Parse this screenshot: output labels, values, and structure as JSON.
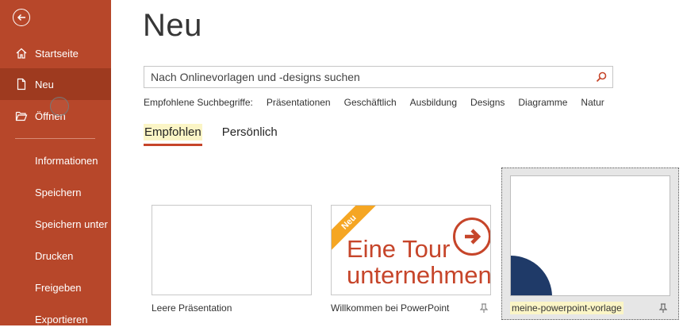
{
  "sidebar": {
    "items": [
      {
        "label": "Startseite",
        "icon": "home-icon"
      },
      {
        "label": "Neu",
        "icon": "new-file-icon",
        "active": true
      },
      {
        "label": "Öffnen",
        "icon": "folder-open-icon"
      }
    ],
    "sub_items": [
      {
        "label": "Informationen"
      },
      {
        "label": "Speichern"
      },
      {
        "label": "Speichern unter"
      },
      {
        "label": "Drucken"
      },
      {
        "label": "Freigeben"
      },
      {
        "label": "Exportieren"
      }
    ],
    "accent": "#b7472a"
  },
  "main": {
    "title": "Neu",
    "search": {
      "placeholder": "Nach Onlinevorlagen und -designs suchen"
    },
    "suggestions": {
      "lead": "Empfohlene Suchbegriffe:",
      "terms": [
        "Präsentationen",
        "Geschäftlich",
        "Ausbildung",
        "Designs",
        "Diagramme",
        "Natur"
      ]
    },
    "tabs": [
      {
        "label": "Empfohlen",
        "active": true
      },
      {
        "label": "Persönlich"
      }
    ],
    "templates": [
      {
        "label": "Leere Präsentation"
      },
      {
        "label": "Willkommen bei PowerPoint",
        "badge": "Neu",
        "thumb_line1": "Eine Tour",
        "thumb_line2": "unternehmen"
      },
      {
        "label": "meine-powerpoint-vorlage",
        "selected": true
      }
    ]
  }
}
